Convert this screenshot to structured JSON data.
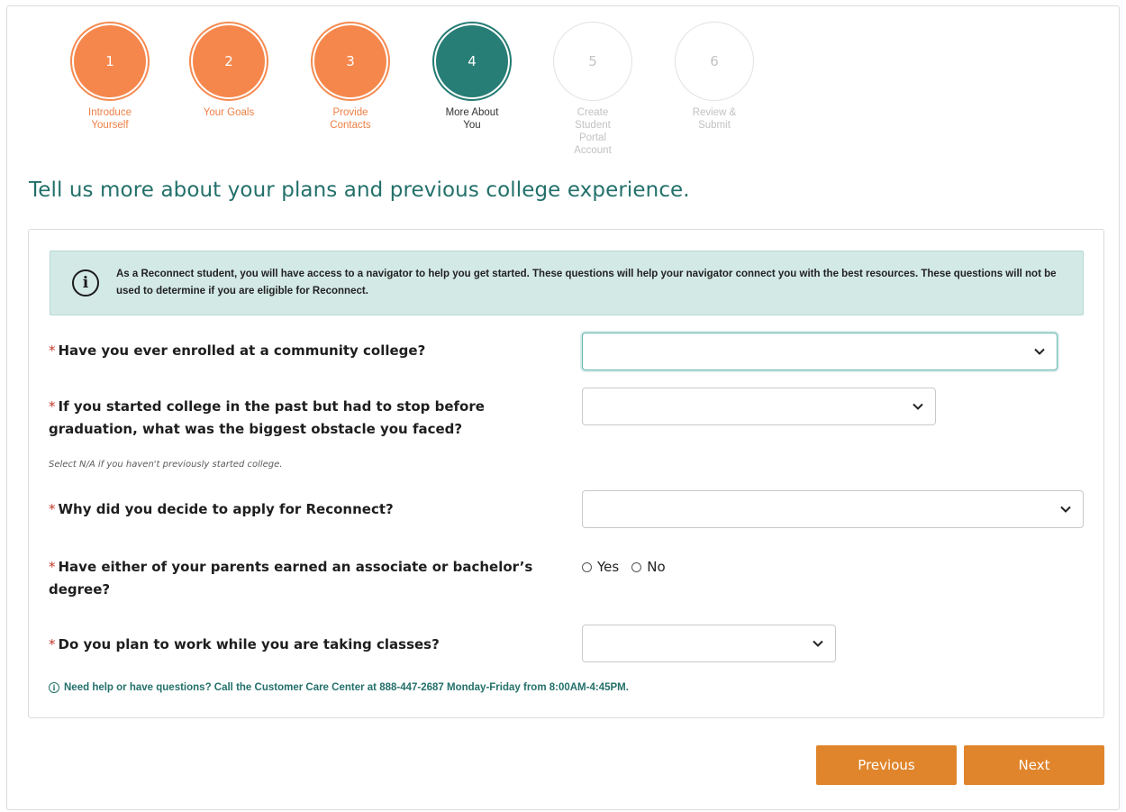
{
  "stepper": [
    {
      "number": "1",
      "label": "Introduce Yourself",
      "state": "done"
    },
    {
      "number": "2",
      "label": "Your Goals",
      "state": "done"
    },
    {
      "number": "3",
      "label": "Provide Contacts",
      "state": "done"
    },
    {
      "number": "4",
      "label": "More About You",
      "state": "active"
    },
    {
      "number": "5",
      "label": "Create Student Portal Account",
      "state": "todo"
    },
    {
      "number": "6",
      "label": "Review & Submit",
      "state": "todo"
    }
  ],
  "heading": "Tell us more about your plans and previous college experience.",
  "notice": {
    "icon": "info-icon",
    "text": "As a Reconnect student, you will have access to a navigator to help you get started. These questions will help your navigator connect you with the best resources. These questions will not be used to determine if you are eligible for Reconnect."
  },
  "questions": {
    "required_marker": "*",
    "q1": {
      "label": "Have you ever enrolled at a community college?",
      "value": ""
    },
    "q2": {
      "label": "If you started college in the past but had to stop before graduation, what was the biggest obstacle you faced?",
      "value": "",
      "hint": "Select N/A if you haven't previously started college."
    },
    "q3": {
      "label": "Why did you decide to apply for Reconnect?",
      "value": ""
    },
    "q4": {
      "label": "Have either of your parents earned an associate or bachelor’s degree?",
      "options": [
        "Yes",
        "No"
      ]
    },
    "q5": {
      "label": "Do you plan to work while you are taking classes?",
      "value": ""
    }
  },
  "help_text": "Need help or have questions? Call the Customer Care Center at 888-447-2687 Monday-Friday from 8:00AM-4:45PM.",
  "buttons": {
    "previous": "Previous",
    "next": "Next"
  },
  "colors": {
    "done": "#f5874c",
    "active": "#277e76",
    "accent": "#23706a",
    "button": "#e0852b"
  }
}
